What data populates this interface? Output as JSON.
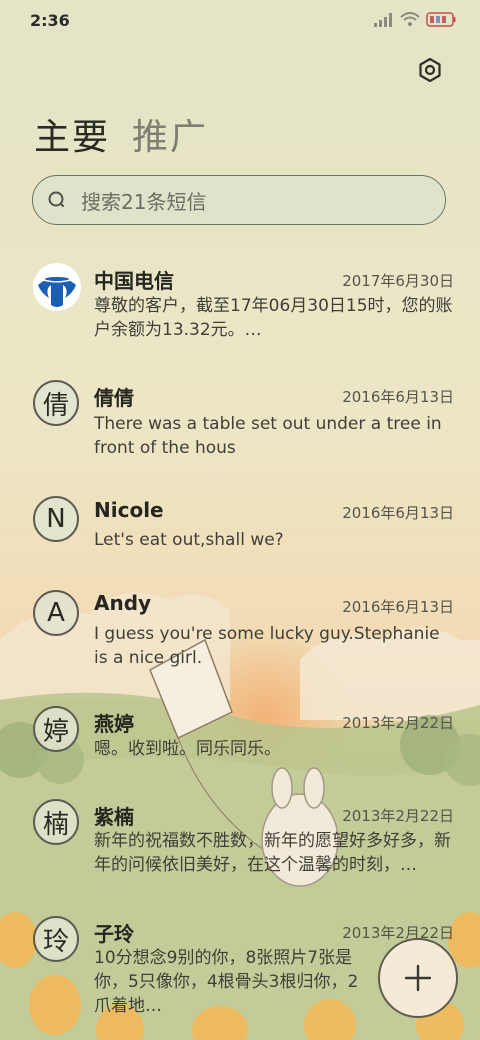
{
  "status_bar": {
    "time": "2:36"
  },
  "tabs": [
    {
      "label": "主要",
      "active": true
    },
    {
      "label": "推广",
      "active": false
    }
  ],
  "search": {
    "placeholder": "搜索21条短信"
  },
  "conversations": [
    {
      "avatar": "",
      "avatar_icon": "china-telecom-logo-icon",
      "name": "中国电信",
      "date": "2017年6月30日",
      "preview": "尊敬的客户，截至17年06月30日15时，您的账户余额为13.32元。…"
    },
    {
      "avatar": "倩",
      "name": "倩倩",
      "date": "2016年6月13日",
      "preview": "There was a table set out under a tree in front of the hous"
    },
    {
      "avatar": "N",
      "name": "Nicole",
      "date": "2016年6月13日",
      "preview": "Let's eat out,shall we?"
    },
    {
      "avatar": "A",
      "name": "Andy",
      "date": "2016年6月13日",
      "preview": "I guess you're some lucky guy.Stephanie is a nice girl."
    },
    {
      "avatar": "婷",
      "name": "燕婷",
      "date": "2013年2月22日",
      "preview": "嗯。收到啦。同乐同乐。"
    },
    {
      "avatar": "楠",
      "name": "紫楠",
      "date": "2013年2月22日",
      "preview": "新年的祝福数不胜数，新年的愿望好多好多，新年的问候依旧美好，在这个温馨的时刻，…"
    },
    {
      "avatar": "玲",
      "name": "子玲",
      "date": "2013年2月22日",
      "preview": "10分想念9别的你，8张照片7张是你，5只像你，4根骨头3根归你，2爪着地…"
    }
  ],
  "icons": {
    "settings": "settings-icon",
    "search": "search-icon",
    "new_message": "plus-icon",
    "signal": "signal-icon",
    "wifi": "wifi-icon",
    "battery": "battery-icon"
  },
  "colors": {
    "accent_border": "#5e5a4e",
    "telecom_blue": "#1a5fb4"
  }
}
